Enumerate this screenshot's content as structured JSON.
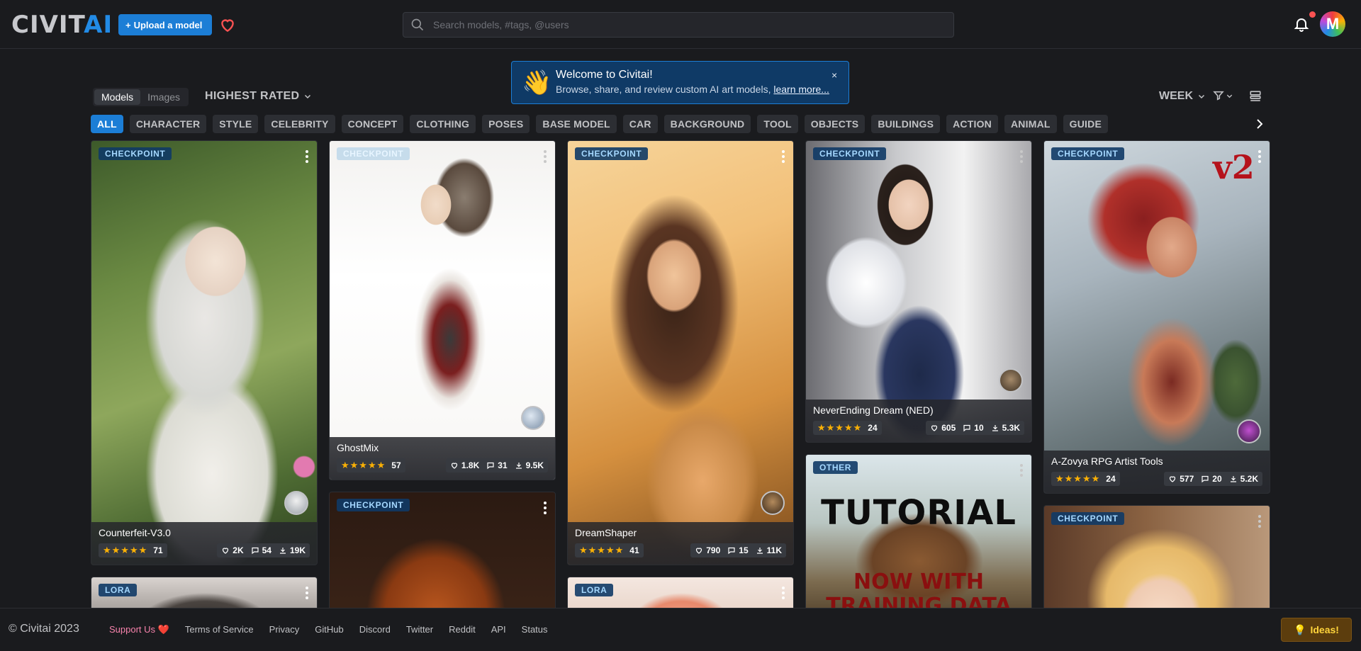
{
  "header": {
    "logo_text_1": "CIVIT",
    "logo_text_2": "AI",
    "upload_label": "Upload a model",
    "search_placeholder": "Search models, #tags, @users",
    "avatar_letter": "M"
  },
  "banner": {
    "emoji": "👋",
    "title": "Welcome to Civitai!",
    "subtitle": "Browse, share, and review custom AI art models, ",
    "link": "learn more...",
    "close": "×"
  },
  "controls": {
    "tabs": [
      "Models",
      "Images"
    ],
    "active_tab": "Models",
    "sort": "HIGHEST RATED",
    "period": "WEEK"
  },
  "categories": [
    "ALL",
    "CHARACTER",
    "STYLE",
    "CELEBRITY",
    "CONCEPT",
    "CLOTHING",
    "POSES",
    "BASE MODEL",
    "CAR",
    "BACKGROUND",
    "TOOL",
    "OBJECTS",
    "BUILDINGS",
    "ACTION",
    "ANIMAL",
    "GUIDE"
  ],
  "cards": [
    {
      "badge": "CHECKPOINT",
      "name": "Counterfeit-V3.0",
      "rating": "71",
      "likes": "2K",
      "comments": "54",
      "downloads": "19K"
    },
    {
      "badge": "CHECKPOINT",
      "name": "GhostMix",
      "rating": "57",
      "likes": "1.8K",
      "comments": "31",
      "downloads": "9.5K"
    },
    {
      "badge": "CHECKPOINT",
      "name": "DreamShaper",
      "rating": "41",
      "likes": "790",
      "comments": "15",
      "downloads": "11K"
    },
    {
      "badge": "CHECKPOINT",
      "name": "NeverEnding Dream (NED)",
      "rating": "24",
      "likes": "605",
      "comments": "10",
      "downloads": "5.3K"
    },
    {
      "badge": "CHECKPOINT",
      "name": "A-Zovya RPG Artist Tools",
      "rating": "24",
      "likes": "577",
      "comments": "20",
      "downloads": "5.2K"
    },
    {
      "badge": "CHECKPOINT"
    },
    {
      "badge": "OTHER",
      "tutorial_line1": "TUTORIAL",
      "tutorial_line2": "NOW WITH",
      "tutorial_line3": "TRAINING DATA"
    },
    {
      "badge": "CHECKPOINT"
    },
    {
      "badge": "LORA"
    },
    {
      "badge": "LORA"
    }
  ],
  "footer": {
    "copyright": "© Civitai 2023",
    "links": [
      "Support Us ❤️",
      "Terms of Service",
      "Privacy",
      "GitHub",
      "Discord",
      "Twitter",
      "Reddit",
      "API",
      "Status"
    ],
    "ideas": "Ideas!"
  },
  "colors": {
    "accent": "#1c7ed6",
    "star": "#fab005",
    "background": "#1a1b1e"
  }
}
